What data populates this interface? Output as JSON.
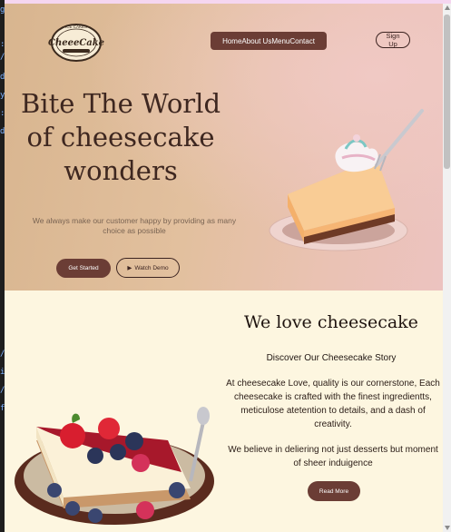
{
  "brand": {
    "logo_top_text": "ICE CAKES",
    "logo_name": "CheeeCake"
  },
  "nav": {
    "items": [
      {
        "label": "Home"
      },
      {
        "label": "About Us"
      },
      {
        "label": "Menu"
      },
      {
        "label": "Contact"
      }
    ],
    "signup_label": "Sign Up"
  },
  "hero": {
    "title_lines": [
      "Bite The World",
      "of cheesecake",
      "wonders"
    ],
    "subtitle": "We always make our customer happy by providing as many choice as possible",
    "primary_button": "Get Started",
    "secondary_button": "Watch Demo",
    "play_icon": "play-icon"
  },
  "about": {
    "title": "We love cheesecake",
    "subtitle": "Discover Our Cheesecake Story",
    "paragraph1": "At cheesecake Love, quality is our cornerstone, Each cheesecake is crafted with the finest ingredientts, meticulose atetention to details, and a dash of creativity.",
    "paragraph2": "We believe in deliering not just desserts but moment of sheer induigence",
    "button": "Read More"
  },
  "colors": {
    "accent_brown": "#6b3d35",
    "dark_text": "#3e2720",
    "cream_bg": "#fdf6e0"
  }
}
